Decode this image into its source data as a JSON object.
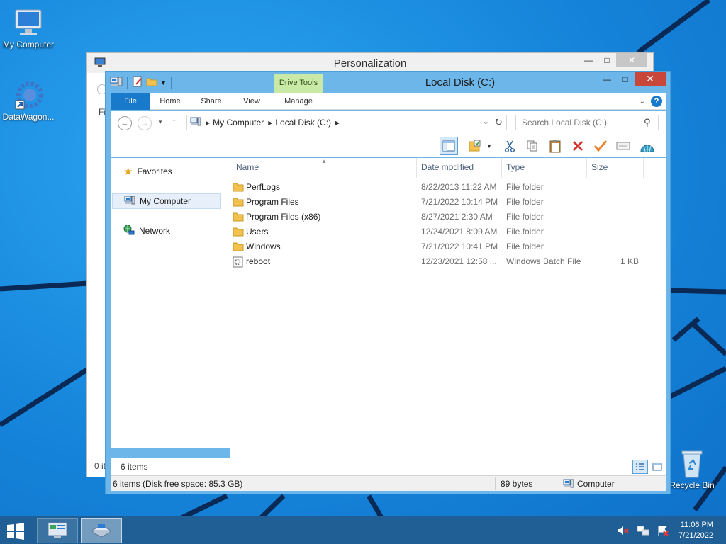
{
  "desktop": {
    "icons": [
      {
        "label": "My Computer"
      },
      {
        "label": "DataWagon..."
      },
      {
        "label": "Recycle Bin"
      }
    ]
  },
  "back_window": {
    "title": "Personalization",
    "stub_text": "Fi",
    "stub_status": "0 it"
  },
  "explorer": {
    "title": "Local Disk (C:)",
    "context_tab": "Drive Tools",
    "ribbon_tabs": [
      "File",
      "Home",
      "Share",
      "View",
      "Manage"
    ],
    "address": {
      "crumbs": [
        "My Computer",
        "Local Disk (C:)"
      ]
    },
    "search": {
      "placeholder": "Search Local Disk (C:)"
    },
    "nav": {
      "items": [
        {
          "label": "Favorites",
          "icon": "star-icon"
        },
        {
          "label": "My Computer",
          "icon": "computer-icon"
        },
        {
          "label": "Network",
          "icon": "network-icon"
        }
      ]
    },
    "columns": [
      "Name",
      "Date modified",
      "Type",
      "Size"
    ],
    "files": [
      {
        "name": "PerfLogs",
        "date": "8/22/2013 11:22 AM",
        "type": "File folder",
        "size": "",
        "icon": "folder-icon"
      },
      {
        "name": "Program Files",
        "date": "7/21/2022 10:14 PM",
        "type": "File folder",
        "size": "",
        "icon": "folder-icon"
      },
      {
        "name": "Program Files (x86)",
        "date": "8/27/2021 2:30 AM",
        "type": "File folder",
        "size": "",
        "icon": "folder-icon"
      },
      {
        "name": "Users",
        "date": "12/24/2021 8:09 AM",
        "type": "File folder",
        "size": "",
        "icon": "folder-icon"
      },
      {
        "name": "Windows",
        "date": "7/21/2022 10:41 PM",
        "type": "File folder",
        "size": "",
        "icon": "folder-icon"
      },
      {
        "name": "reboot",
        "date": "12/23/2021 12:58 ...",
        "type": "Windows Batch File",
        "size": "1 KB",
        "icon": "batch-file-icon"
      }
    ],
    "item_count": "6 items",
    "status": {
      "left": "6 items (Disk free space: 85.3 GB)",
      "size": "89 bytes",
      "location": "Computer"
    }
  },
  "taskbar": {
    "clock_time": "11:06 PM",
    "clock_date": "7/21/2022"
  },
  "colors": {
    "accent": "#1979ca",
    "title_active": "#6db6ea",
    "close": "#c9463b",
    "drive_tools": "#c9e9a6",
    "taskbar": "#1f5f96"
  }
}
